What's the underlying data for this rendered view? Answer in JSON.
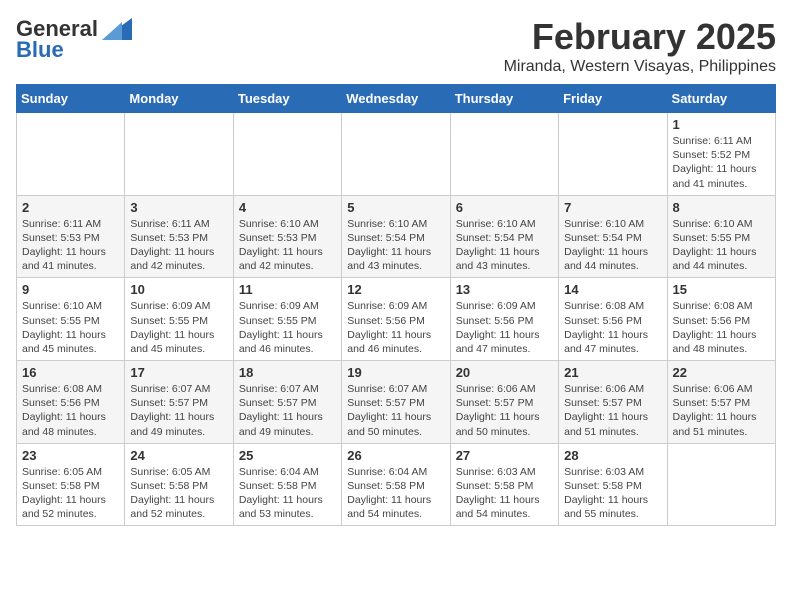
{
  "header": {
    "logo_general": "General",
    "logo_blue": "Blue",
    "month": "February 2025",
    "location": "Miranda, Western Visayas, Philippines"
  },
  "days_of_week": [
    "Sunday",
    "Monday",
    "Tuesday",
    "Wednesday",
    "Thursday",
    "Friday",
    "Saturday"
  ],
  "weeks": [
    [
      {
        "day": "",
        "info": ""
      },
      {
        "day": "",
        "info": ""
      },
      {
        "day": "",
        "info": ""
      },
      {
        "day": "",
        "info": ""
      },
      {
        "day": "",
        "info": ""
      },
      {
        "day": "",
        "info": ""
      },
      {
        "day": "1",
        "info": "Sunrise: 6:11 AM\nSunset: 5:52 PM\nDaylight: 11 hours\nand 41 minutes."
      }
    ],
    [
      {
        "day": "2",
        "info": "Sunrise: 6:11 AM\nSunset: 5:53 PM\nDaylight: 11 hours\nand 41 minutes."
      },
      {
        "day": "3",
        "info": "Sunrise: 6:11 AM\nSunset: 5:53 PM\nDaylight: 11 hours\nand 42 minutes."
      },
      {
        "day": "4",
        "info": "Sunrise: 6:10 AM\nSunset: 5:53 PM\nDaylight: 11 hours\nand 42 minutes."
      },
      {
        "day": "5",
        "info": "Sunrise: 6:10 AM\nSunset: 5:54 PM\nDaylight: 11 hours\nand 43 minutes."
      },
      {
        "day": "6",
        "info": "Sunrise: 6:10 AM\nSunset: 5:54 PM\nDaylight: 11 hours\nand 43 minutes."
      },
      {
        "day": "7",
        "info": "Sunrise: 6:10 AM\nSunset: 5:54 PM\nDaylight: 11 hours\nand 44 minutes."
      },
      {
        "day": "8",
        "info": "Sunrise: 6:10 AM\nSunset: 5:55 PM\nDaylight: 11 hours\nand 44 minutes."
      }
    ],
    [
      {
        "day": "9",
        "info": "Sunrise: 6:10 AM\nSunset: 5:55 PM\nDaylight: 11 hours\nand 45 minutes."
      },
      {
        "day": "10",
        "info": "Sunrise: 6:09 AM\nSunset: 5:55 PM\nDaylight: 11 hours\nand 45 minutes."
      },
      {
        "day": "11",
        "info": "Sunrise: 6:09 AM\nSunset: 5:55 PM\nDaylight: 11 hours\nand 46 minutes."
      },
      {
        "day": "12",
        "info": "Sunrise: 6:09 AM\nSunset: 5:56 PM\nDaylight: 11 hours\nand 46 minutes."
      },
      {
        "day": "13",
        "info": "Sunrise: 6:09 AM\nSunset: 5:56 PM\nDaylight: 11 hours\nand 47 minutes."
      },
      {
        "day": "14",
        "info": "Sunrise: 6:08 AM\nSunset: 5:56 PM\nDaylight: 11 hours\nand 47 minutes."
      },
      {
        "day": "15",
        "info": "Sunrise: 6:08 AM\nSunset: 5:56 PM\nDaylight: 11 hours\nand 48 minutes."
      }
    ],
    [
      {
        "day": "16",
        "info": "Sunrise: 6:08 AM\nSunset: 5:56 PM\nDaylight: 11 hours\nand 48 minutes."
      },
      {
        "day": "17",
        "info": "Sunrise: 6:07 AM\nSunset: 5:57 PM\nDaylight: 11 hours\nand 49 minutes."
      },
      {
        "day": "18",
        "info": "Sunrise: 6:07 AM\nSunset: 5:57 PM\nDaylight: 11 hours\nand 49 minutes."
      },
      {
        "day": "19",
        "info": "Sunrise: 6:07 AM\nSunset: 5:57 PM\nDaylight: 11 hours\nand 50 minutes."
      },
      {
        "day": "20",
        "info": "Sunrise: 6:06 AM\nSunset: 5:57 PM\nDaylight: 11 hours\nand 50 minutes."
      },
      {
        "day": "21",
        "info": "Sunrise: 6:06 AM\nSunset: 5:57 PM\nDaylight: 11 hours\nand 51 minutes."
      },
      {
        "day": "22",
        "info": "Sunrise: 6:06 AM\nSunset: 5:57 PM\nDaylight: 11 hours\nand 51 minutes."
      }
    ],
    [
      {
        "day": "23",
        "info": "Sunrise: 6:05 AM\nSunset: 5:58 PM\nDaylight: 11 hours\nand 52 minutes."
      },
      {
        "day": "24",
        "info": "Sunrise: 6:05 AM\nSunset: 5:58 PM\nDaylight: 11 hours\nand 52 minutes."
      },
      {
        "day": "25",
        "info": "Sunrise: 6:04 AM\nSunset: 5:58 PM\nDaylight: 11 hours\nand 53 minutes."
      },
      {
        "day": "26",
        "info": "Sunrise: 6:04 AM\nSunset: 5:58 PM\nDaylight: 11 hours\nand 54 minutes."
      },
      {
        "day": "27",
        "info": "Sunrise: 6:03 AM\nSunset: 5:58 PM\nDaylight: 11 hours\nand 54 minutes."
      },
      {
        "day": "28",
        "info": "Sunrise: 6:03 AM\nSunset: 5:58 PM\nDaylight: 11 hours\nand 55 minutes."
      },
      {
        "day": "",
        "info": ""
      }
    ]
  ]
}
